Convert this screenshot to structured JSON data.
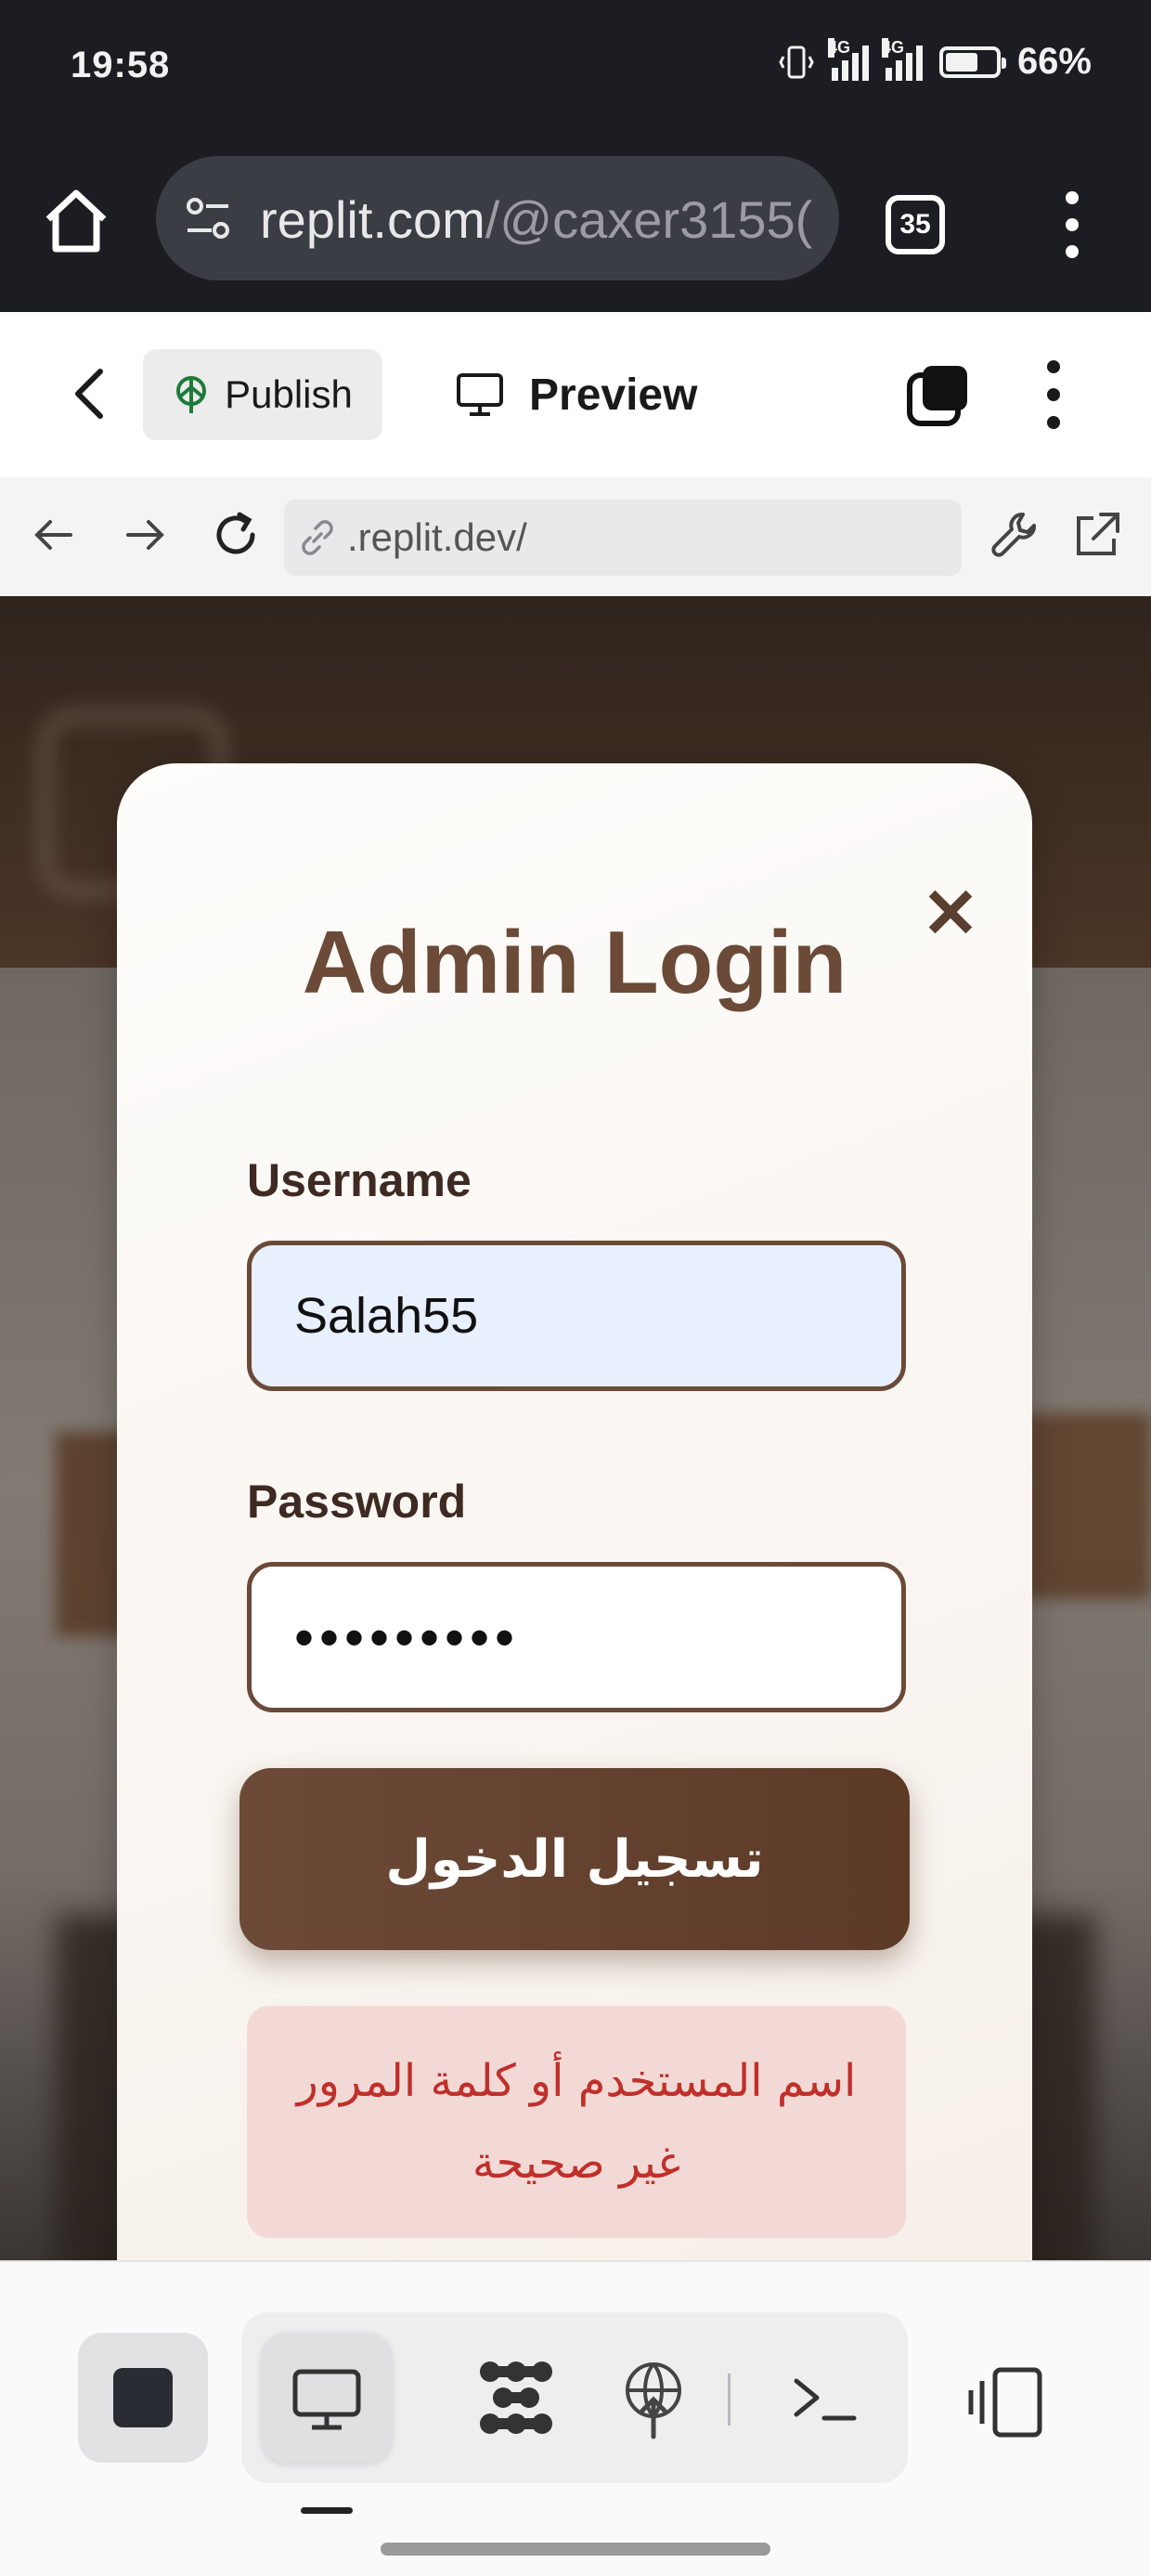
{
  "status_bar": {
    "time": "19:58",
    "network_1": "4G",
    "network_2": "4G",
    "battery": "66%",
    "battery_level": 0.66
  },
  "browser": {
    "url_host": "replit.com",
    "url_path": "/@caxer3155(",
    "tab_count": "35",
    "icons": [
      "home-icon",
      "site-settings-icon",
      "tab-switcher-icon",
      "menu-icon"
    ]
  },
  "replit_toolbar": {
    "publish_label": "Publish",
    "preview_label": "Preview"
  },
  "webview_address": {
    "url": ".replit.dev/"
  },
  "login_modal": {
    "title": "Admin Login",
    "close_symbol": "✕",
    "username_label": "Username",
    "username_value": "Salah55",
    "password_label": "Password",
    "password_value": "•••••••••",
    "submit_label": "تسجيل الدخول",
    "error_line_1": "اسم المستخدم أو كلمة المرور",
    "error_line_2": "غير صحيحة"
  },
  "bottom_toolbar": {
    "tools": [
      "stop-icon",
      "preview-icon",
      "workflows-icon",
      "deploy-icon",
      "shell-icon",
      "split-view-icon"
    ],
    "active_tool": "preview-icon"
  },
  "colors": {
    "brand_brown": "#6b4a38",
    "error_text": "#c0302b",
    "error_bg": "#f3d9d5",
    "username_bg": "#e8effd"
  }
}
